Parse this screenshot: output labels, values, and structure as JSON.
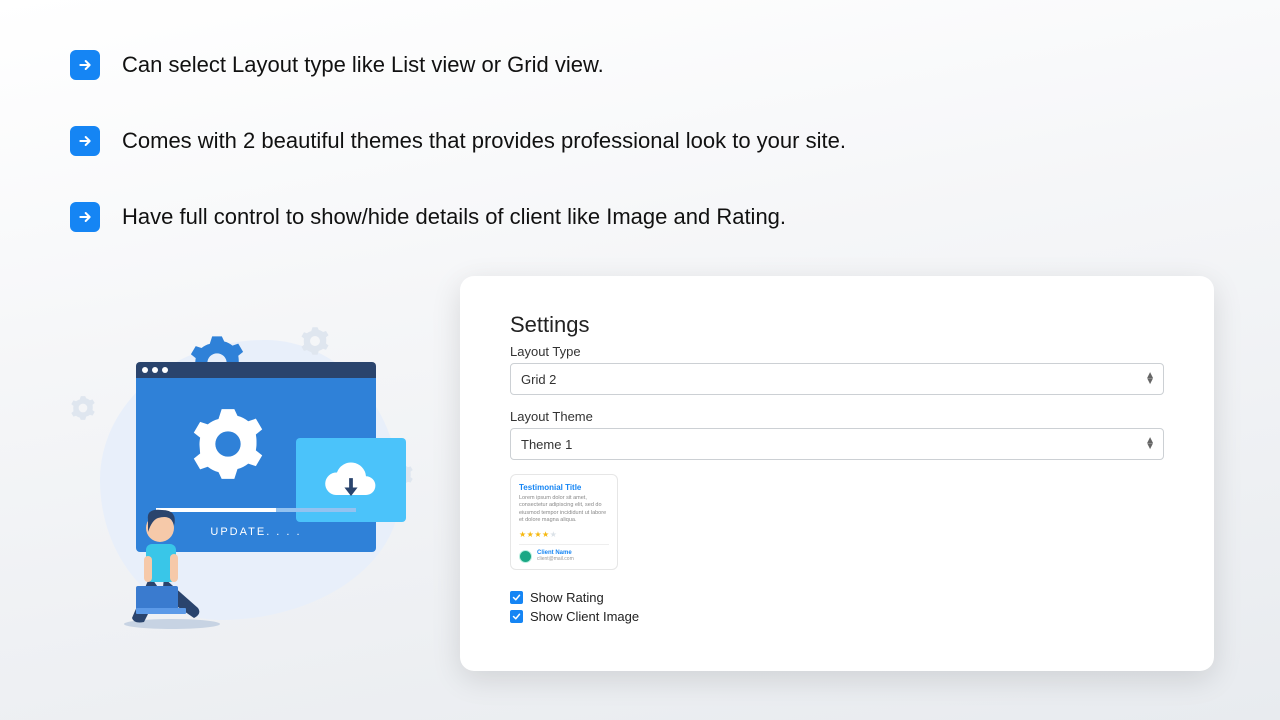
{
  "features": [
    "Can select Layout type like List view or Grid view.",
    "Comes with 2 beautiful themes that provides professional look to your site.",
    "Have full control to show/hide details of client like Image and Rating."
  ],
  "illustration": {
    "update_label": "UPDATE. . . ."
  },
  "settings": {
    "title": "Settings",
    "layout_type_label": "Layout Type",
    "layout_type_value": "Grid 2",
    "layout_theme_label": "Layout Theme",
    "layout_theme_value": "Theme 1",
    "preview": {
      "title": "Testimonial Title",
      "body": "Lorem ipsum dolor sit amet, consectetur adipiscing elit, sed do eiusmod tempor incididunt ut labore et dolore magna aliqua.",
      "client_name": "Client Name",
      "client_email": "client@mail.com"
    },
    "show_rating_label": "Show Rating",
    "show_client_image_label": "Show Client Image",
    "show_rating_checked": true,
    "show_client_image_checked": true
  },
  "colors": {
    "accent": "#1585f4"
  }
}
